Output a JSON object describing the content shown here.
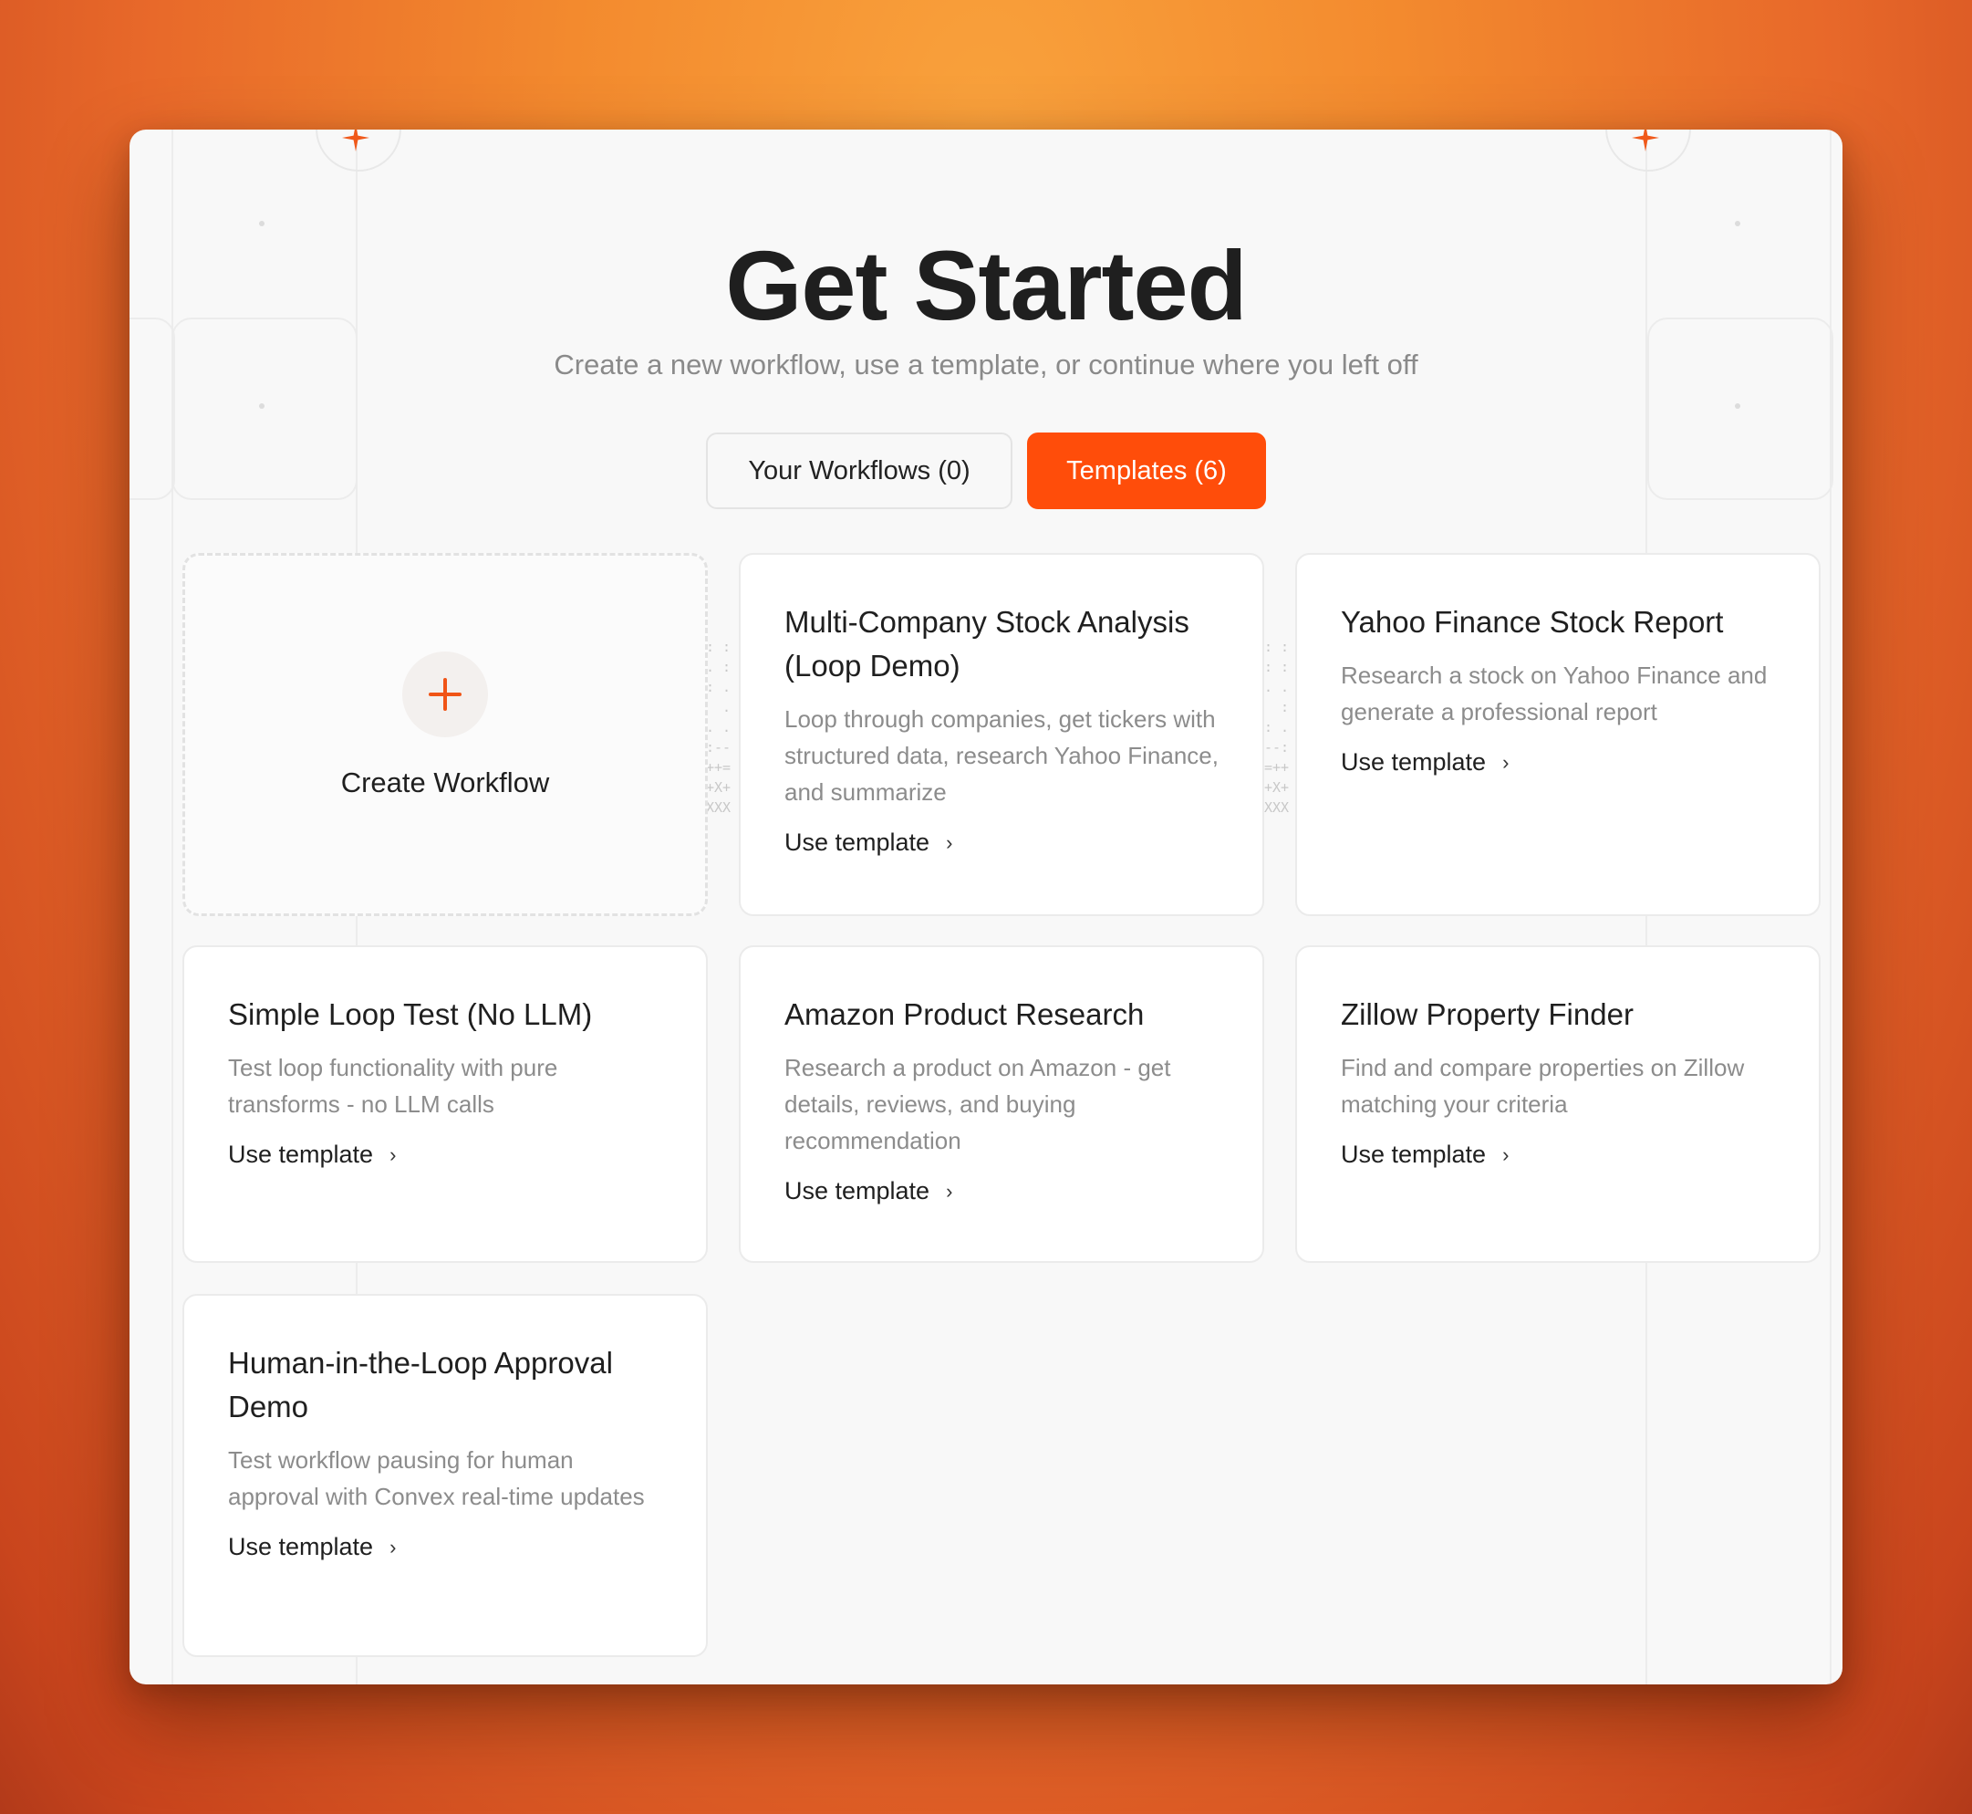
{
  "header": {
    "title": "Get Started",
    "subtitle": "Create a new workflow, use a template, or continue where you left off"
  },
  "tabs": [
    {
      "label": "Your Workflows (0)",
      "active": false
    },
    {
      "label": "Templates (6)",
      "active": true
    }
  ],
  "create_card": {
    "label": "Create Workflow",
    "icon": "plus-icon"
  },
  "templates": [
    {
      "title": "Multi-Company Stock Analysis (Loop Demo)",
      "description": "Loop through companies, get tickers with structured data, research Yahoo Finance, and summarize",
      "action": "Use template"
    },
    {
      "title": "Yahoo Finance Stock Report",
      "description": "Research a stock on Yahoo Finance and generate a professional report",
      "action": "Use template"
    },
    {
      "title": "Simple Loop Test (No LLM)",
      "description": "Test loop functionality with pure transforms - no LLM calls",
      "action": "Use template"
    },
    {
      "title": "Amazon Product Research",
      "description": "Research a product on Amazon - get details, reviews, and buying recommendation",
      "action": "Use template"
    },
    {
      "title": "Zillow Property Finder",
      "description": "Find and compare properties on Zillow matching your criteria",
      "action": "Use template"
    },
    {
      "title": "Human-in-the-Loop Approval Demo",
      "description": "Test workflow pausing for human approval with Convex real-time updates",
      "action": "Use template"
    }
  ],
  "colors": {
    "accent": "#ff4d0a",
    "title": "#1f1f1f",
    "muted": "#8c8c8c"
  }
}
